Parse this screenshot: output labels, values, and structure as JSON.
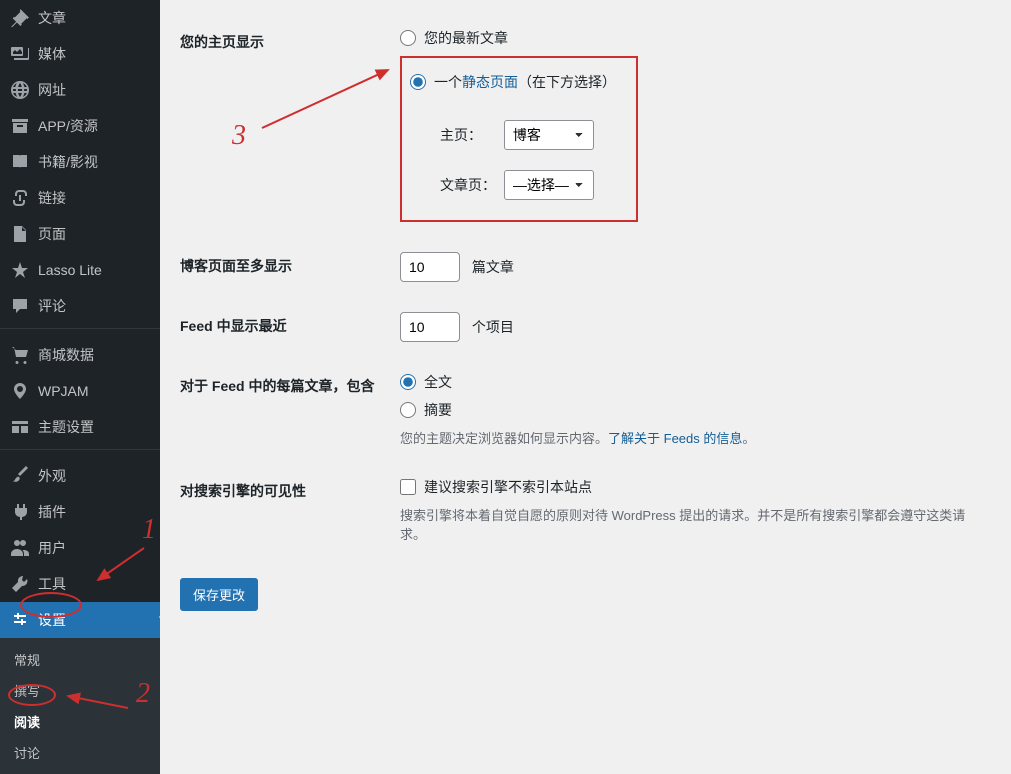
{
  "sidebar": {
    "items": [
      {
        "label": "文章",
        "icon": "pin"
      },
      {
        "label": "媒体",
        "icon": "media"
      },
      {
        "label": "网址",
        "icon": "globe"
      },
      {
        "label": "APP/资源",
        "icon": "archive"
      },
      {
        "label": "书籍/影视",
        "icon": "book"
      },
      {
        "label": "链接",
        "icon": "link"
      },
      {
        "label": "页面",
        "icon": "page"
      },
      {
        "label": "Lasso Lite",
        "icon": "lasso"
      },
      {
        "label": "评论",
        "icon": "comment"
      },
      {
        "label": "商城数据",
        "icon": "cart"
      },
      {
        "label": "WPJAM",
        "icon": "wpjam"
      },
      {
        "label": "主题设置",
        "icon": "theme"
      },
      {
        "label": "外观",
        "icon": "brush"
      },
      {
        "label": "插件",
        "icon": "plugin"
      },
      {
        "label": "用户",
        "icon": "users"
      },
      {
        "label": "工具",
        "icon": "wrench"
      },
      {
        "label": "设置",
        "icon": "settings",
        "active": true
      }
    ],
    "submenu": [
      "常规",
      "撰写",
      "阅读",
      "讨论"
    ],
    "submenu_current": "阅读"
  },
  "annotations": {
    "n1": "1",
    "n2": "2",
    "n3": "3"
  },
  "form": {
    "homepage_label": "您的主页显示",
    "opt_latest": "您的最新文章",
    "opt_static_prefix": "一个",
    "opt_static_link": "静态页面",
    "opt_static_suffix": "（在下方选择）",
    "home_label": "主页：",
    "home_value": "博客",
    "posts_label": "文章页：",
    "posts_value": "—选择—",
    "blog_max_label": "博客页面至多显示",
    "blog_max_value": "10",
    "blog_max_unit": "篇文章",
    "feed_recent_label": "Feed 中显示最近",
    "feed_recent_value": "10",
    "feed_recent_unit": "个项目",
    "feed_content_label": "对于 Feed 中的每篇文章，包含",
    "feed_full": "全文",
    "feed_summary": "摘要",
    "feed_desc_prefix": "您的主题决定浏览器如何显示内容。",
    "feed_desc_link": "了解关于 Feeds 的信息",
    "seo_label": "对搜索引擎的可见性",
    "seo_checkbox": "建议搜索引擎不索引本站点",
    "seo_desc": "搜索引擎将本着自觉自愿的原则对待 WordPress 提出的请求。并不是所有搜索引擎都会遵守这类请求。",
    "save": "保存更改"
  }
}
